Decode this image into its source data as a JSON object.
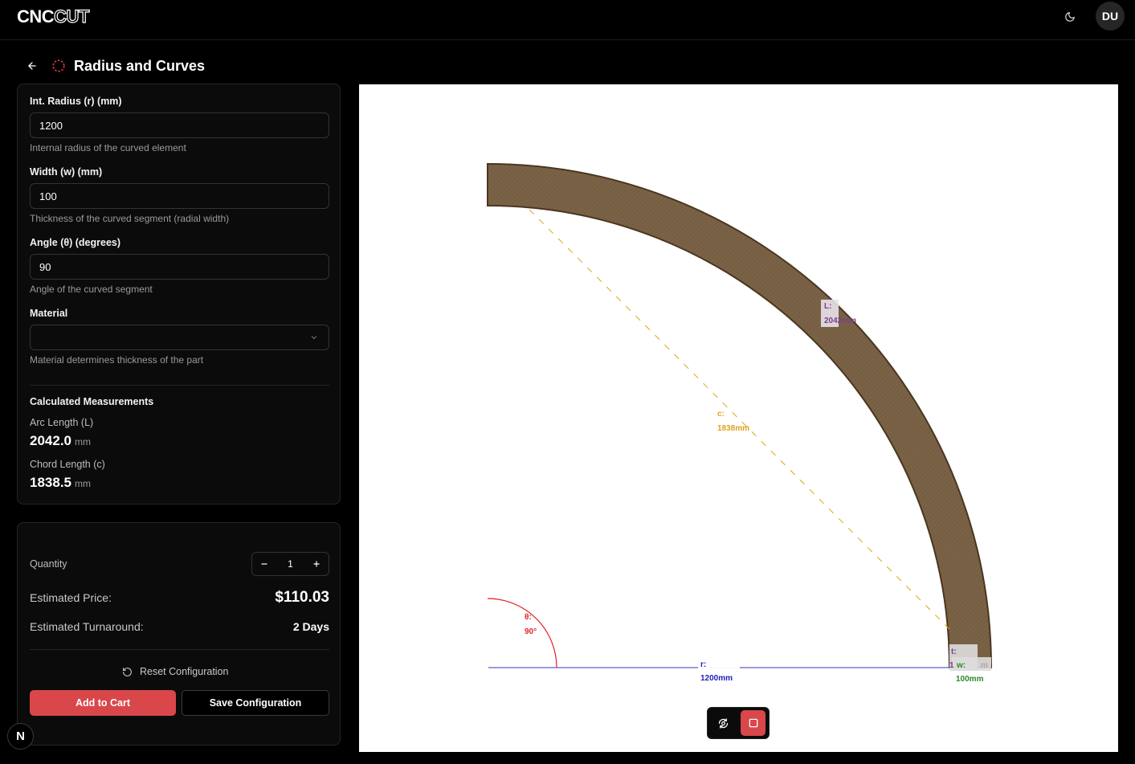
{
  "app": {
    "logo_main": "CNC",
    "logo_accent": "CUT",
    "avatar_initials": "DU"
  },
  "page": {
    "title": "Radius and Curves"
  },
  "fields": {
    "radius": {
      "label": "Int. Radius (r) (mm)",
      "value": "1200",
      "help": "Internal radius of the curved element"
    },
    "width": {
      "label": "Width (w) (mm)",
      "value": "100",
      "help": "Thickness of the curved segment (radial width)"
    },
    "angle": {
      "label": "Angle (θ) (degrees)",
      "value": "90",
      "help": "Angle of the curved segment"
    },
    "material": {
      "label": "Material",
      "value": "",
      "help": "Material determines thickness of the part"
    }
  },
  "measurements": {
    "title": "Calculated Measurements",
    "arc": {
      "label": "Arc Length (L)",
      "value": "2042.0",
      "unit": "mm"
    },
    "chord": {
      "label": "Chord Length (c)",
      "value": "1838.5",
      "unit": "mm"
    }
  },
  "order": {
    "quantity_label": "Quantity",
    "quantity": "1",
    "price_label": "Estimated Price:",
    "price": "$110.03",
    "turnaround_label": "Estimated Turnaround:",
    "turnaround": "2 Days",
    "reset_label": "Reset Configuration",
    "add_to_cart": "Add to Cart",
    "save": "Save Configuration"
  },
  "drawing": {
    "arc_label_prefix": "L:",
    "arc_label_value": "2042mm",
    "chord_label_prefix": "c:",
    "chord_label_value": "1838mm",
    "angle_label_prefix": "θ:",
    "angle_label_value": "90°",
    "radius_label_prefix": "r:",
    "radius_label_value": "1200mm",
    "thickness_label_prefix": "t:",
    "thickness_label_partial": "1",
    "thickness_label_suffix": "m",
    "width_label_prefix": "w:",
    "width_label_value": "100mm",
    "colors": {
      "wood": "#7a6246",
      "wood_edge": "#4a3620",
      "arc": "#7b3f8c",
      "chord": "#e0a21e",
      "angle": "#e02626",
      "radius": "#2222bb",
      "width": "#2a8a2a"
    }
  },
  "badge": {
    "label": "N"
  }
}
